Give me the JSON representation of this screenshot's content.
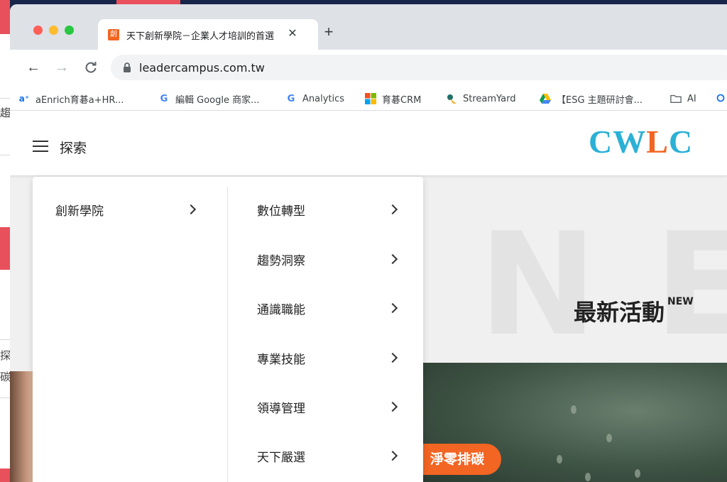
{
  "browser": {
    "tab_title": "天下創新學院－企業人才培訓的首選",
    "tab_favicon": "創",
    "url": "leadercampus.com.tw",
    "bookmarks": [
      {
        "icon": "aenrich-icon",
        "label": "aEnrich育碁a+HR..."
      },
      {
        "icon": "google-icon",
        "label": "編輯 Google 商家..."
      },
      {
        "icon": "google-icon",
        "label": "Analytics"
      },
      {
        "icon": "microsoft-icon",
        "label": "育碁CRM"
      },
      {
        "icon": "streamyard-icon",
        "label": "StreamYard"
      },
      {
        "icon": "google-drive-icon",
        "label": "【ESG 主題研討會..."
      },
      {
        "icon": "folder-icon",
        "label": "AI"
      }
    ]
  },
  "site": {
    "explore_label": "探索",
    "logo": {
      "prefix": "CW",
      "highlight": "L",
      "suffix": "C"
    },
    "hero_watermark": "NEW",
    "section_title": "最新活動",
    "section_badge": "NEW",
    "pill_text": "淨零排碳",
    "colors": {
      "brand_blue": "#2bb0d6",
      "brand_orange": "#f26522"
    }
  },
  "menu": {
    "primary": "創新學院",
    "items": [
      "數位轉型",
      "趨勢洞察",
      "通識職能",
      "專業技能",
      "領導管理",
      "天下嚴選"
    ]
  },
  "background": {
    "chars": [
      "趨",
      "探",
      "碳"
    ]
  }
}
